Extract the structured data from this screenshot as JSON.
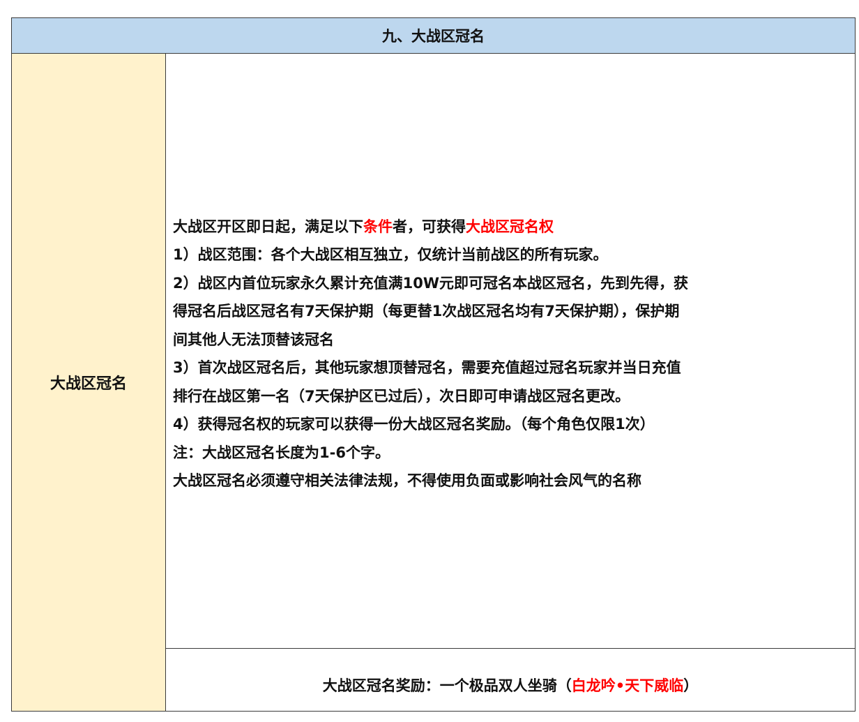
{
  "header": {
    "title": "九、大战区冠名"
  },
  "left_label": "大战区冠名",
  "rules": {
    "intro_prefix": "大战区开区即日起，满足以下",
    "intro_highlight_1": "条件",
    "intro_middle": "者，可获得",
    "intro_highlight_2": "大战区冠名权",
    "line_1": "1）战区范围：各个大战区相互独立，仅统计当前战区的所有玩家。",
    "line_2a": "2）战区内首位玩家永久累计充值满10W元即可冠名本战区冠名，先到先得，获",
    "line_2b": "得冠名后战区冠名有7天保护期（每更替1次战区冠名均有7天保护期），保护期",
    "line_2c": "间其他人无法顶替该冠名",
    "line_3a": "3）首次战区冠名后，其他玩家想顶替冠名，需要充值超过冠名玩家并当日充值",
    "line_3b": "排行在战区第一名（7天保护区已过后），次日即可申请战区冠名更改。",
    "line_4": "4）获得冠名权的玩家可以获得一份大战区冠名奖励。（每个角色仅限1次）",
    "note": "注：大战区冠名长度为1-6个字。",
    "law": "大战区冠名必须遵守相关法律法规，不得使用负面或影响社会风气的名称"
  },
  "reward": {
    "prefix": "大战区冠名奖励：一个极品双人坐骑（",
    "highlight": "白龙吟•天下威临",
    "suffix": "）"
  },
  "colors": {
    "header_bg": "#bdd7ee",
    "label_bg": "#fff2cc",
    "highlight": "#ff0000",
    "text": "#111111",
    "border": "#3a3a3a"
  }
}
